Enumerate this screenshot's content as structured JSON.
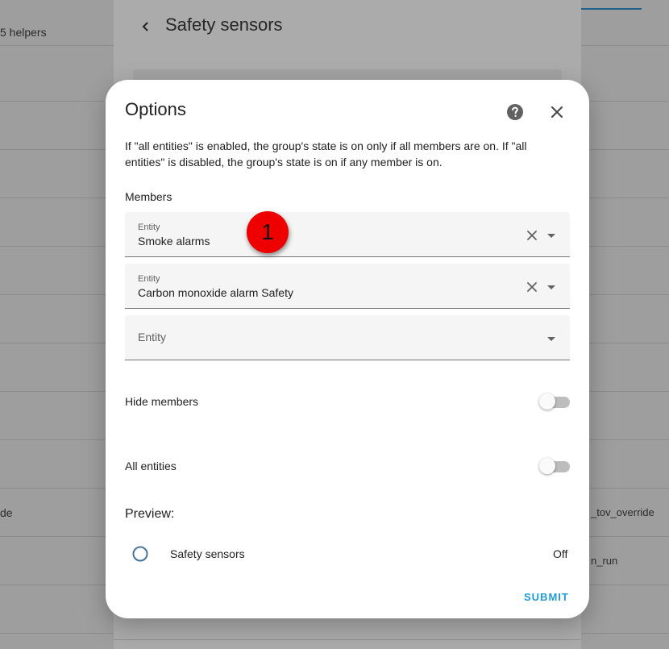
{
  "background": {
    "helpers_text": "5 helpers",
    "row_left_text": "de",
    "row_right_text_1": "_tov_override",
    "row_right_text_2": "n_run",
    "dialog_title": "Safety sensors"
  },
  "modal": {
    "title": "Options",
    "help_icon": "help-circle-icon",
    "close_icon": "close-icon",
    "description": "If \"all entities\" is enabled, the group's state is on only if all members are on. If \"all entities\" is disabled, the group's state is on if any member is on.",
    "members_label": "Members",
    "fields": [
      {
        "label": "Entity",
        "value": "Smoke alarms"
      },
      {
        "label": "Entity",
        "value": "Carbon monoxide alarm Safety"
      },
      {
        "label": "",
        "placeholder": "Entity",
        "value": ""
      }
    ],
    "annotation_badge": "1",
    "hide_members": {
      "label": "Hide members",
      "on": false
    },
    "all_entities": {
      "label": "All entities",
      "on": false
    },
    "preview": {
      "title": "Preview:",
      "entity_name": "Safety sensors",
      "state": "Off",
      "icon": "circle-outline-icon",
      "icon_color": "#44739e"
    },
    "submit_label": "SUBMIT"
  },
  "colors": {
    "accent": "#1e9bd7",
    "badge": "#ee0000"
  }
}
